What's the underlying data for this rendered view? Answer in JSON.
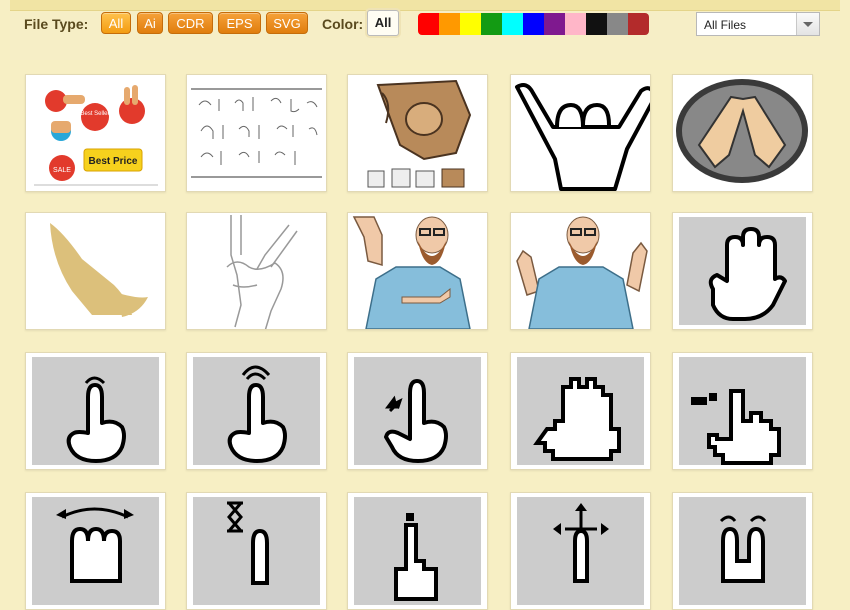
{
  "filter_bar": {
    "file_type_label": "File Type:",
    "file_types": [
      "All",
      "Ai",
      "CDR",
      "EPS",
      "SVG"
    ],
    "active_file_type": "All",
    "color_label": "Color:",
    "color_all_label": "All",
    "colors": [
      "#ff0000",
      "#ff9900",
      "#ffff00",
      "#139b13",
      "#00ffff",
      "#0000ff",
      "#7f198f",
      "#ffb6c8",
      "#111111",
      "#888888",
      "#b32b2b"
    ],
    "files_select": {
      "value": "All Files"
    }
  },
  "thumbnails": [
    {
      "name": "hand-pointing-badges",
      "badge_text": "Best Price",
      "bubble_text_1": "Best Seller",
      "bubble_text_2": "SALE"
    },
    {
      "name": "sign-language-sheet"
    },
    {
      "name": "pointing-fist"
    },
    {
      "name": "shaka-hand"
    },
    {
      "name": "diamond-hands-oval"
    },
    {
      "name": "praying-hands"
    },
    {
      "name": "rock-hand-sketch"
    },
    {
      "name": "bearded-man-pointing"
    },
    {
      "name": "bearded-man-shrug"
    },
    {
      "name": "open-hand-gray"
    },
    {
      "name": "tap-gesture-1"
    },
    {
      "name": "tap-gesture-2"
    },
    {
      "name": "pinch-gesture"
    },
    {
      "name": "pixel-hand-open"
    },
    {
      "name": "pixel-hand-pinch"
    },
    {
      "name": "swipe-gesture"
    },
    {
      "name": "hourglass-tap"
    },
    {
      "name": "pixel-pointer"
    },
    {
      "name": "move-gesture"
    },
    {
      "name": "two-finger-tap"
    }
  ]
}
